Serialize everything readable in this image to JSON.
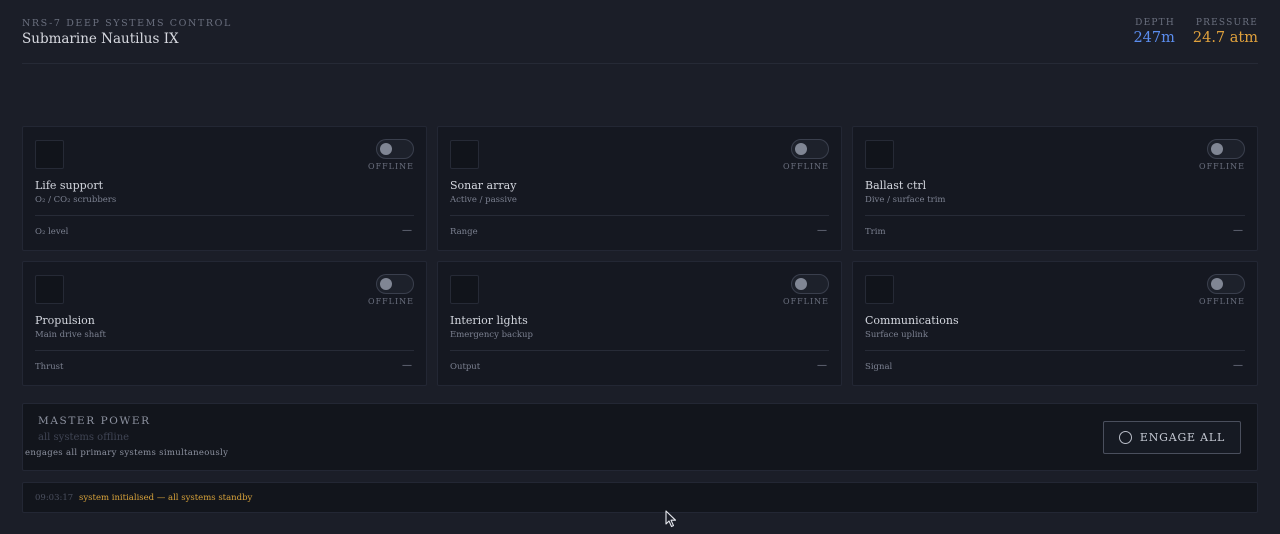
{
  "header": {
    "subtitle": "NRS-7 DEEP SYSTEMS CONTROL",
    "title": "Submarine Nautilus IX",
    "depth": {
      "label": "DEPTH",
      "value": "247m"
    },
    "pressure": {
      "label": "PRESSURE",
      "value": "24.7 atm"
    }
  },
  "systems": [
    {
      "name": "Life support",
      "desc": "O₂ / CO₂ scrubbers",
      "metric_label": "O₂ level",
      "metric_value": "—",
      "status": "OFFLINE"
    },
    {
      "name": "Sonar array",
      "desc": "Active / passive",
      "metric_label": "Range",
      "metric_value": "—",
      "status": "OFFLINE"
    },
    {
      "name": "Ballast ctrl",
      "desc": "Dive / surface trim",
      "metric_label": "Trim",
      "metric_value": "—",
      "status": "OFFLINE"
    },
    {
      "name": "Propulsion",
      "desc": "Main drive shaft",
      "metric_label": "Thrust",
      "metric_value": "—",
      "status": "OFFLINE"
    },
    {
      "name": "Interior lights",
      "desc": "Emergency backup",
      "metric_label": "Output",
      "metric_value": "—",
      "status": "OFFLINE"
    },
    {
      "name": "Communications",
      "desc": "Surface uplink",
      "metric_label": "Signal",
      "metric_value": "—",
      "status": "OFFLINE"
    }
  ],
  "master": {
    "title": "MASTER POWER",
    "state": "all systems offline",
    "desc": "engages all primary systems simultaneously",
    "button_label": "ENGAGE ALL"
  },
  "log": {
    "time": "09:03:17",
    "message": "system initialised — all systems standby"
  },
  "colors": {
    "depth": "#5b8def",
    "pressure": "#e0a13c",
    "log_message": "#d7a23a"
  }
}
